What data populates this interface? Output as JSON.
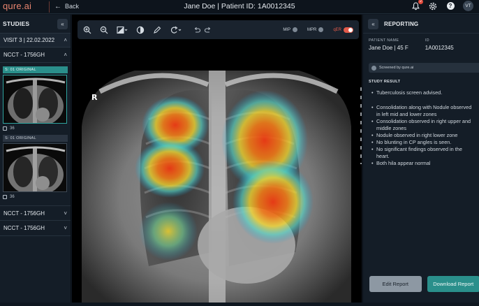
{
  "app": {
    "logo": "qure.ai",
    "back_label": "Back"
  },
  "header": {
    "title": "Jane Doe | Patient ID: 1A0012345",
    "notification_count": "2",
    "avatar_initials": "VT"
  },
  "left_panel": {
    "title": "STUDIES",
    "visit": "VISIT 3 | 22.02.2022",
    "series": [
      {
        "label": "NCCT - 1756GH",
        "expanded": true
      },
      {
        "label": "NCCT - 1756GH",
        "expanded": false
      },
      {
        "label": "NCCT - 1756GH",
        "expanded": false
      }
    ],
    "thumbnails": [
      {
        "tag": "S: 01  ORIGINAL",
        "count": "36",
        "active": true
      },
      {
        "tag": "S: 01  ORIGINAL",
        "count": "36",
        "active": false
      }
    ]
  },
  "toolbar": {
    "mip_label": "MIP",
    "mpr_label": "MPR",
    "qer_label": "qER"
  },
  "viewer": {
    "orientation_marker": "R"
  },
  "report": {
    "title": "REPORTING",
    "patient_name_label": "PATIENT NAME",
    "patient_name": "Jane Doe | 45 F",
    "id_label": "ID",
    "id_value": "1A0012345",
    "screened_by": "Screened by qure.ai",
    "study_result_label": "STUDY RESULT",
    "findings": [
      "Tuberculosis screen advised.",
      "Consolidation along with Nodule observed in left mid and lower zones",
      "Consolidation observed in right upper and middle zones",
      "Nodule observed in right lower zone",
      "No blunting in CP angles is seen.",
      "No significant findings observed in the heart.",
      "Both hila appear normal"
    ],
    "edit_button": "Edit Report",
    "download_button": "Download Report"
  },
  "colors": {
    "accent": "#2a8f8b",
    "brand": "#e8856f",
    "alert": "#e25a4a"
  }
}
